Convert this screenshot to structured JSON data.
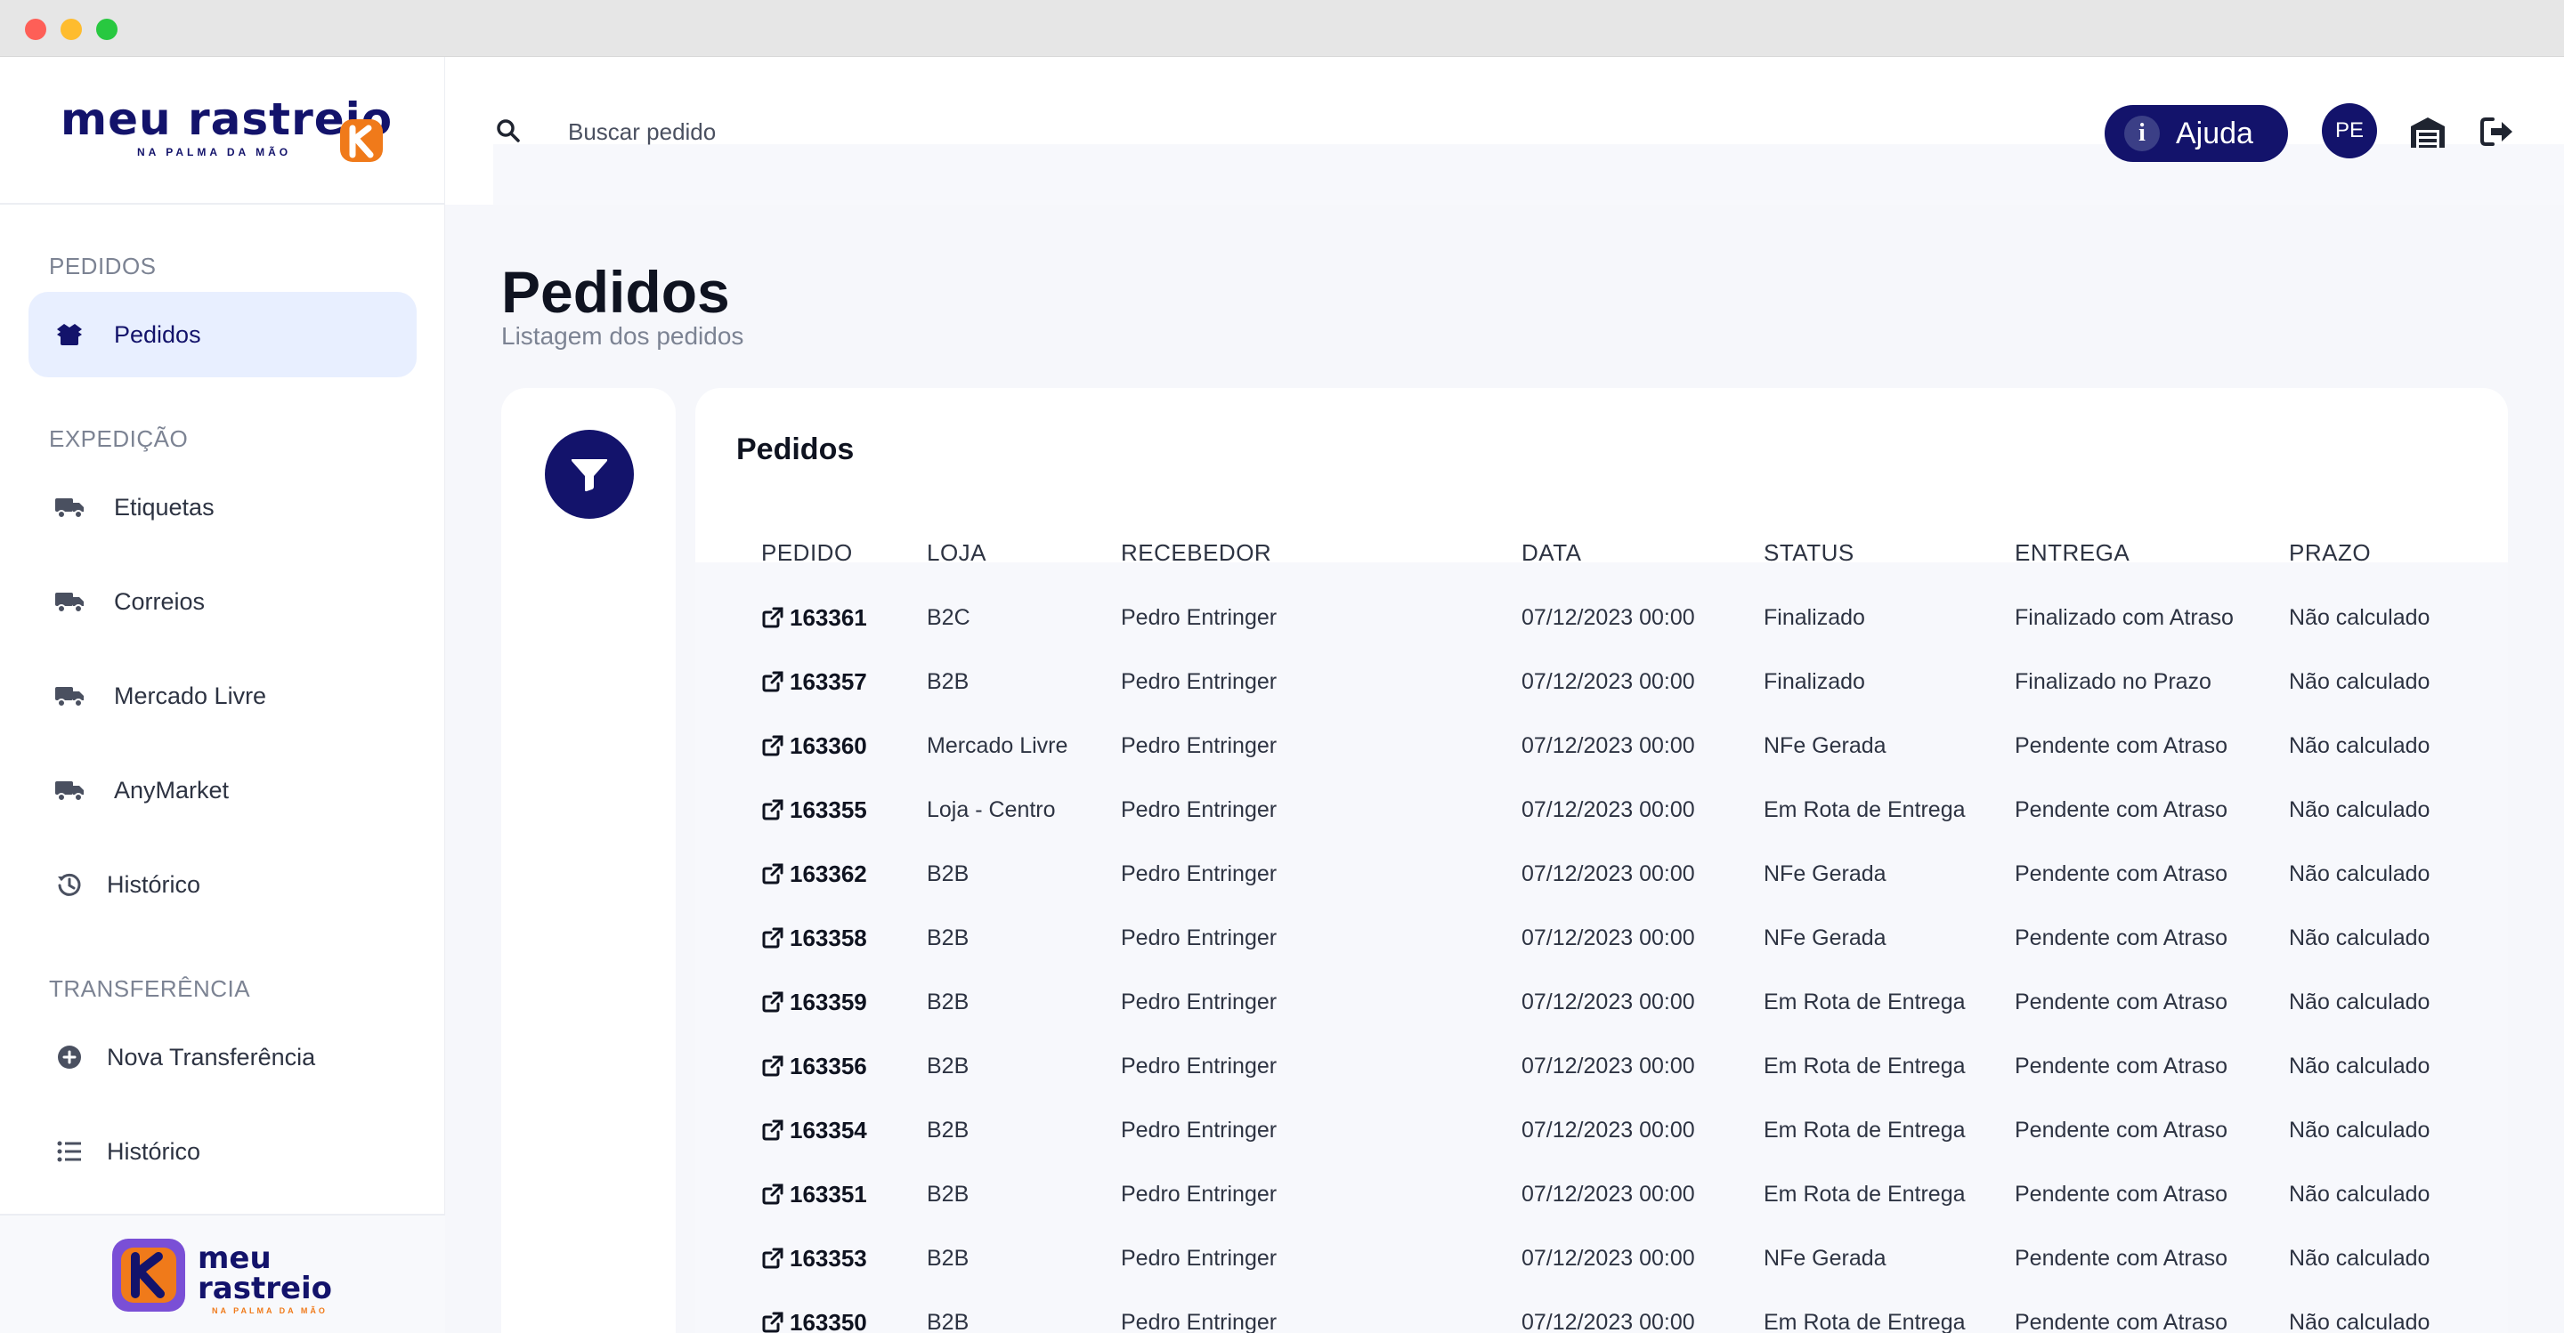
{
  "brand": {
    "logo_text": "meu rastreio",
    "tagline": "NA PALMA DA MÃO",
    "footer_line1": "meu",
    "footer_line2": "rastreio",
    "footer_tagline": "NA PALMA DA MÃO",
    "colors": {
      "navy": "#13136b",
      "orange": "#f07a1a"
    }
  },
  "sidebar": {
    "sections": [
      {
        "label": "PEDIDOS"
      },
      {
        "label": "EXPEDIÇÃO"
      },
      {
        "label": "TRANSFERÊNCIA"
      }
    ],
    "items": [
      {
        "label": "Pedidos",
        "icon": "boxes-icon",
        "active": true
      },
      {
        "label": "Etiquetas",
        "icon": "truck-icon"
      },
      {
        "label": "Correios",
        "icon": "truck-icon"
      },
      {
        "label": "Mercado Livre",
        "icon": "truck-icon"
      },
      {
        "label": "AnyMarket",
        "icon": "truck-icon"
      },
      {
        "label": "Histórico",
        "icon": "history-icon"
      },
      {
        "label": "Nova Transferência",
        "icon": "plus-circle-icon"
      },
      {
        "label": "Histórico",
        "icon": "list-icon"
      }
    ]
  },
  "header": {
    "search_placeholder": "Buscar pedido",
    "help_label": "Ajuda",
    "avatar_initials": "PE"
  },
  "page": {
    "title": "Pedidos",
    "subtitle": "Listagem dos pedidos"
  },
  "orders": {
    "card_title": "Pedidos",
    "columns": [
      "PEDIDO",
      "LOJA",
      "RECEBEDOR",
      "DATA",
      "STATUS",
      "ENTREGA",
      "PRAZO"
    ],
    "rows": [
      {
        "id": "163361",
        "store": "B2C",
        "receiver": "Pedro Entringer",
        "date": "07/12/2023 00:00",
        "status": "Finalizado",
        "delivery": "Finalizado com Atraso",
        "deadline": "Não calculado"
      },
      {
        "id": "163357",
        "store": "B2B",
        "receiver": "Pedro Entringer",
        "date": "07/12/2023 00:00",
        "status": "Finalizado",
        "delivery": "Finalizado no Prazo",
        "deadline": "Não calculado"
      },
      {
        "id": "163360",
        "store": "Mercado Livre",
        "receiver": "Pedro Entringer",
        "date": "07/12/2023 00:00",
        "status": "NFe Gerada",
        "delivery": "Pendente com Atraso",
        "deadline": "Não calculado"
      },
      {
        "id": "163355",
        "store": "Loja - Centro",
        "receiver": "Pedro Entringer",
        "date": "07/12/2023 00:00",
        "status": "Em Rota de Entrega",
        "delivery": "Pendente com Atraso",
        "deadline": "Não calculado"
      },
      {
        "id": "163362",
        "store": "B2B",
        "receiver": "Pedro Entringer",
        "date": "07/12/2023 00:00",
        "status": "NFe Gerada",
        "delivery": "Pendente com Atraso",
        "deadline": "Não calculado"
      },
      {
        "id": "163358",
        "store": "B2B",
        "receiver": "Pedro Entringer",
        "date": "07/12/2023 00:00",
        "status": "NFe Gerada",
        "delivery": "Pendente com Atraso",
        "deadline": "Não calculado"
      },
      {
        "id": "163359",
        "store": "B2B",
        "receiver": "Pedro Entringer",
        "date": "07/12/2023 00:00",
        "status": "Em Rota de Entrega",
        "delivery": "Pendente com Atraso",
        "deadline": "Não calculado"
      },
      {
        "id": "163356",
        "store": "B2B",
        "receiver": "Pedro Entringer",
        "date": "07/12/2023 00:00",
        "status": "Em Rota de Entrega",
        "delivery": "Pendente com Atraso",
        "deadline": "Não calculado"
      },
      {
        "id": "163354",
        "store": "B2B",
        "receiver": "Pedro Entringer",
        "date": "07/12/2023 00:00",
        "status": "Em Rota de Entrega",
        "delivery": "Pendente com Atraso",
        "deadline": "Não calculado"
      },
      {
        "id": "163351",
        "store": "B2B",
        "receiver": "Pedro Entringer",
        "date": "07/12/2023 00:00",
        "status": "Em Rota de Entrega",
        "delivery": "Pendente com Atraso",
        "deadline": "Não calculado"
      },
      {
        "id": "163353",
        "store": "B2B",
        "receiver": "Pedro Entringer",
        "date": "07/12/2023 00:00",
        "status": "NFe Gerada",
        "delivery": "Pendente com Atraso",
        "deadline": "Não calculado"
      },
      {
        "id": "163350",
        "store": "B2B",
        "receiver": "Pedro Entringer",
        "date": "07/12/2023 00:00",
        "status": "Em Rota de Entrega",
        "delivery": "Pendente com Atraso",
        "deadline": "Não calculado"
      }
    ]
  }
}
